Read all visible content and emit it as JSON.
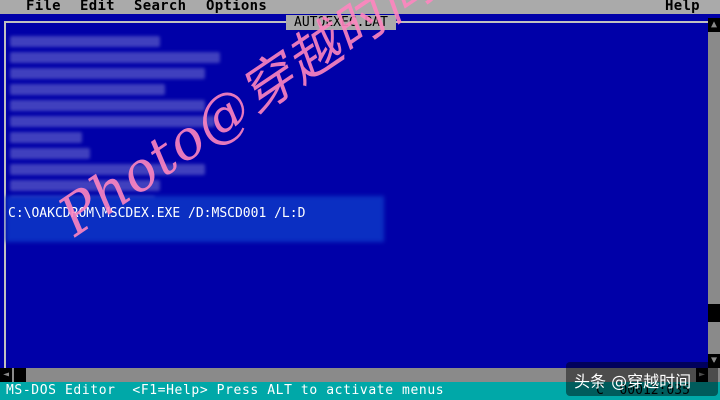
{
  "menubar": {
    "file": "File",
    "edit": "Edit",
    "search": "Search",
    "options": "Options",
    "help": "Help"
  },
  "editor": {
    "filename": "AUTOEXEC.BAT",
    "visible_line": "C:\\OAKCDROM\\MSCDEX.EXE /D:MSCD001 /L:D"
  },
  "watermark": "Photo@穿越时间",
  "statusbar": {
    "text": "MS-DOS Editor  <F1=Help> Press ALT to activate menus",
    "position": "C  00012:035"
  },
  "brand_overlay": "头条 @穿越时间",
  "colors": {
    "background": "#0000a8",
    "menubar": "#aaaaaa",
    "statusbar": "#00a8a8",
    "watermark": "#ff86c0"
  }
}
